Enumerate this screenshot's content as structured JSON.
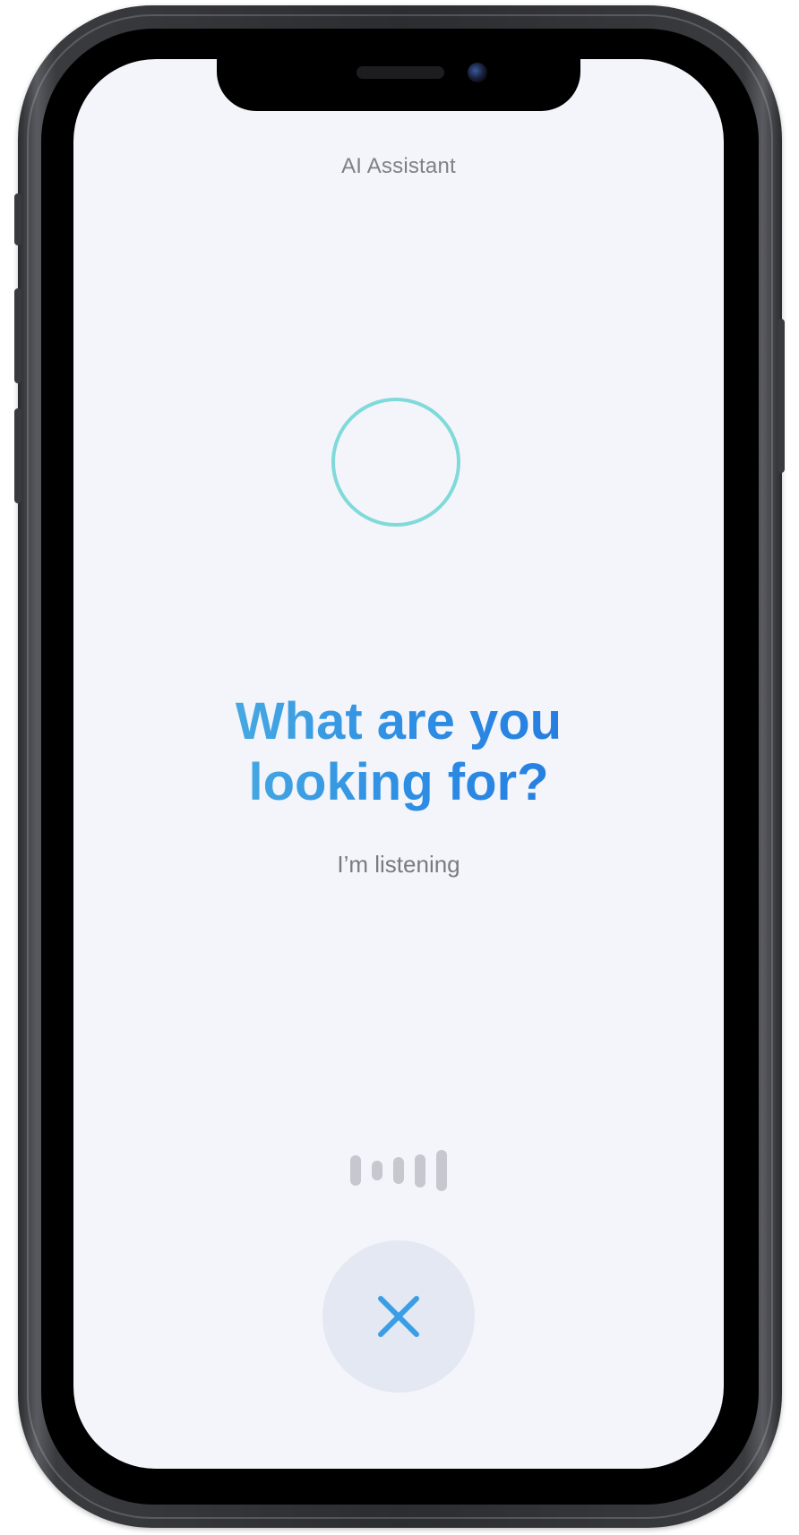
{
  "app": {
    "title": "AI Assistant"
  },
  "prompt": {
    "headline_line1": "What are you",
    "headline_line2": "looking for?",
    "subtitle": "I’m listening"
  },
  "colors": {
    "screen_background": "#f3f5fa",
    "ring": "#7fdad9",
    "headline_gradient_start": "#5cc2e0",
    "headline_gradient_end": "#1b6ede",
    "wave_bars": "#c5c8cf",
    "close_button_bg": "#e4e8f3",
    "close_icon": "#3a9ee6"
  },
  "icons": {
    "listening_indicator": "circle-ring-icon",
    "audio_wave": "voice-wave-icon",
    "close": "close-icon"
  },
  "voice_wave_levels": [
    0.7,
    0.45,
    0.62,
    0.78,
    0.95
  ]
}
